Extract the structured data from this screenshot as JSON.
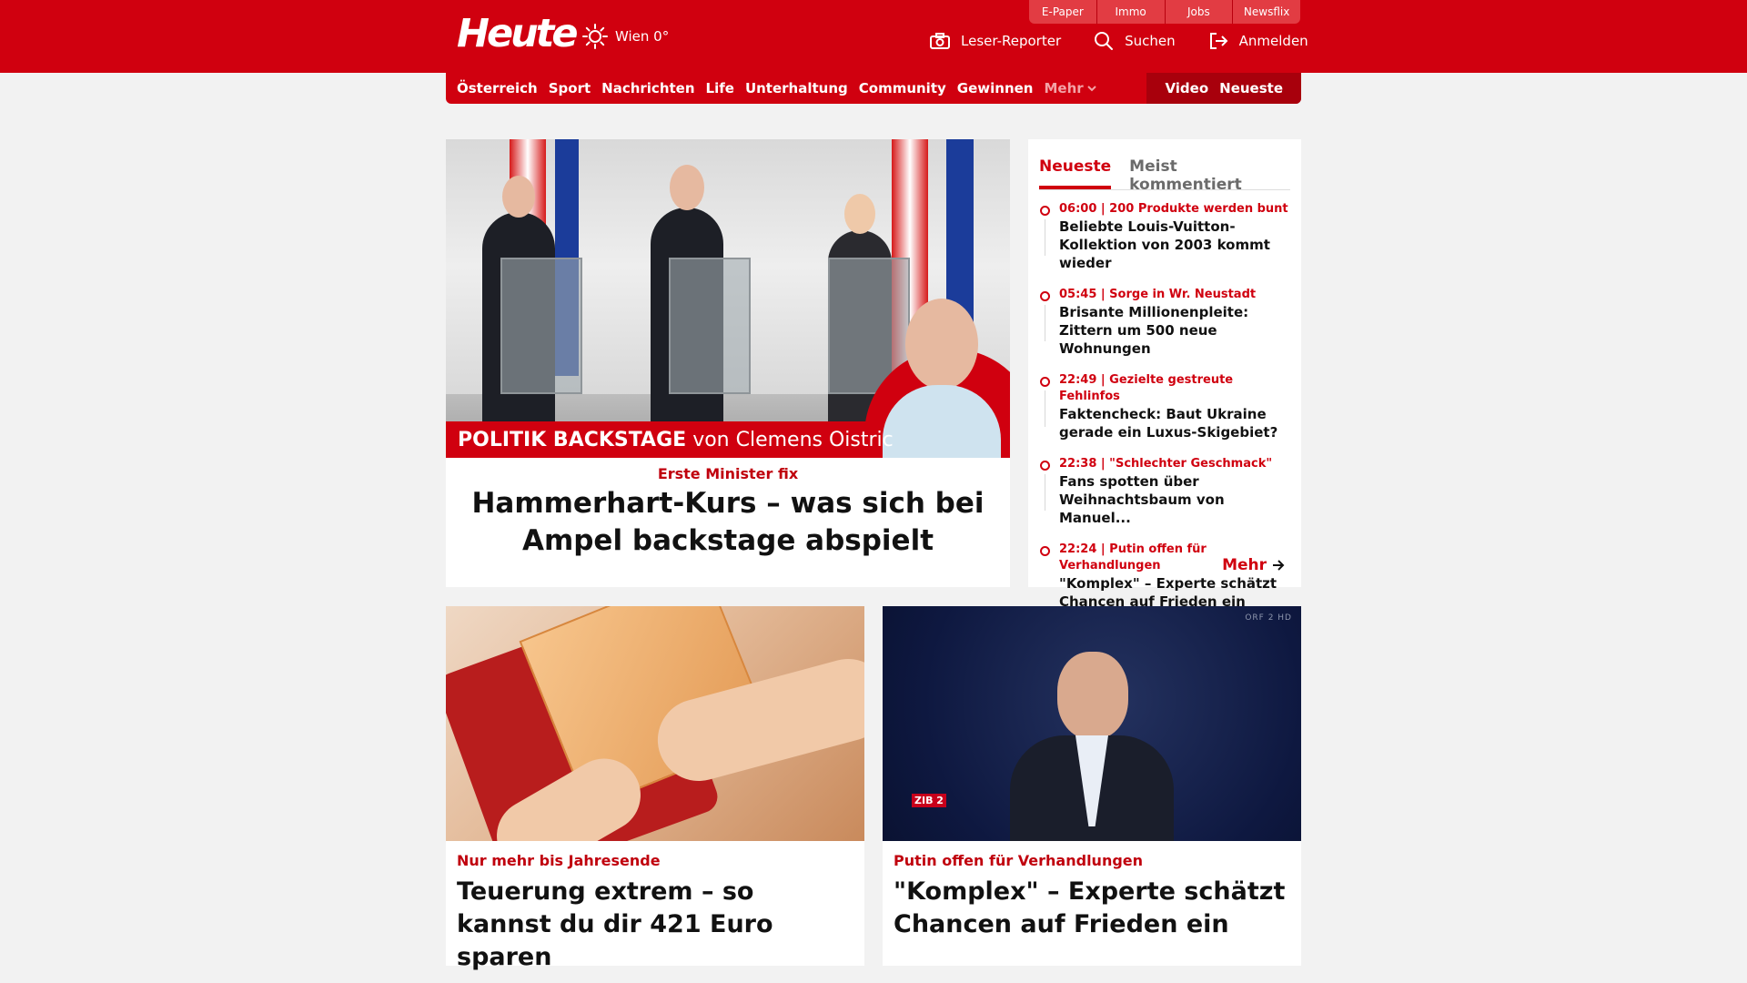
{
  "colors": {
    "brand_red": "#d0000f",
    "dark_red": "#a8000c"
  },
  "top_tabs": [
    "E-Paper",
    "Immo",
    "Jobs",
    "Newsflix"
  ],
  "logo": "Heute",
  "weather": {
    "icon": "sun-icon",
    "text": "Wien 0°"
  },
  "header_actions": [
    {
      "icon": "camera-icon",
      "label": "Leser-Reporter"
    },
    {
      "icon": "search-icon",
      "label": "Suchen"
    },
    {
      "icon": "login-icon",
      "label": "Anmelden"
    }
  ],
  "nav": {
    "items": [
      "Österreich",
      "Sport",
      "Nachrichten",
      "Life",
      "Unterhaltung",
      "Community",
      "Gewinnen"
    ],
    "more": "Mehr",
    "right": [
      "Video",
      "Neueste"
    ]
  },
  "hero": {
    "banner_bold": "POLITIK BACKSTAGE",
    "banner_rest": "von Clemens Oistric",
    "kicker": "Erste Minister fix",
    "title": "Hammerhart-Kurs – was sich bei Ampel backstage abspielt"
  },
  "sidebar": {
    "tabs": [
      "Neueste",
      "Meist kommentiert"
    ],
    "items": [
      {
        "meta": "06:00 | 200 Produkte werden bunt",
        "title": "Beliebte Louis-Vuitton-Kollektion von 2003 kommt wieder"
      },
      {
        "meta": "05:45 | Sorge in Wr. Neustadt",
        "title": "Brisante Millionenpleite: Zittern um 500 neue Wohnungen"
      },
      {
        "meta": "22:49 | Gezielte gestreute Fehlinfos",
        "title": "Faktencheck: Baut Ukraine gerade ein Luxus-Skigebiet?"
      },
      {
        "meta": "22:38 | \"Schlechter Geschmack\"",
        "title": "Fans spotten über Weihnachtsbaum von Manuel..."
      },
      {
        "meta": "22:24 | Putin offen für Verhandlungen",
        "title": "\"Komplex\" – Experte schätzt Chancen auf Frieden ein"
      }
    ],
    "more": "Mehr"
  },
  "cards": [
    {
      "kicker": "Nur mehr bis Jahresende",
      "title": "Teuerung extrem – so kannst du dir 421 Euro sparen"
    },
    {
      "kicker": "Putin offen für Verhandlungen",
      "title": "\"Komplex\" – Experte schätzt Chancen auf Frieden ein",
      "overlay_zib": "ZIB 2",
      "overlay_orf": "ORF 2 HD"
    }
  ]
}
